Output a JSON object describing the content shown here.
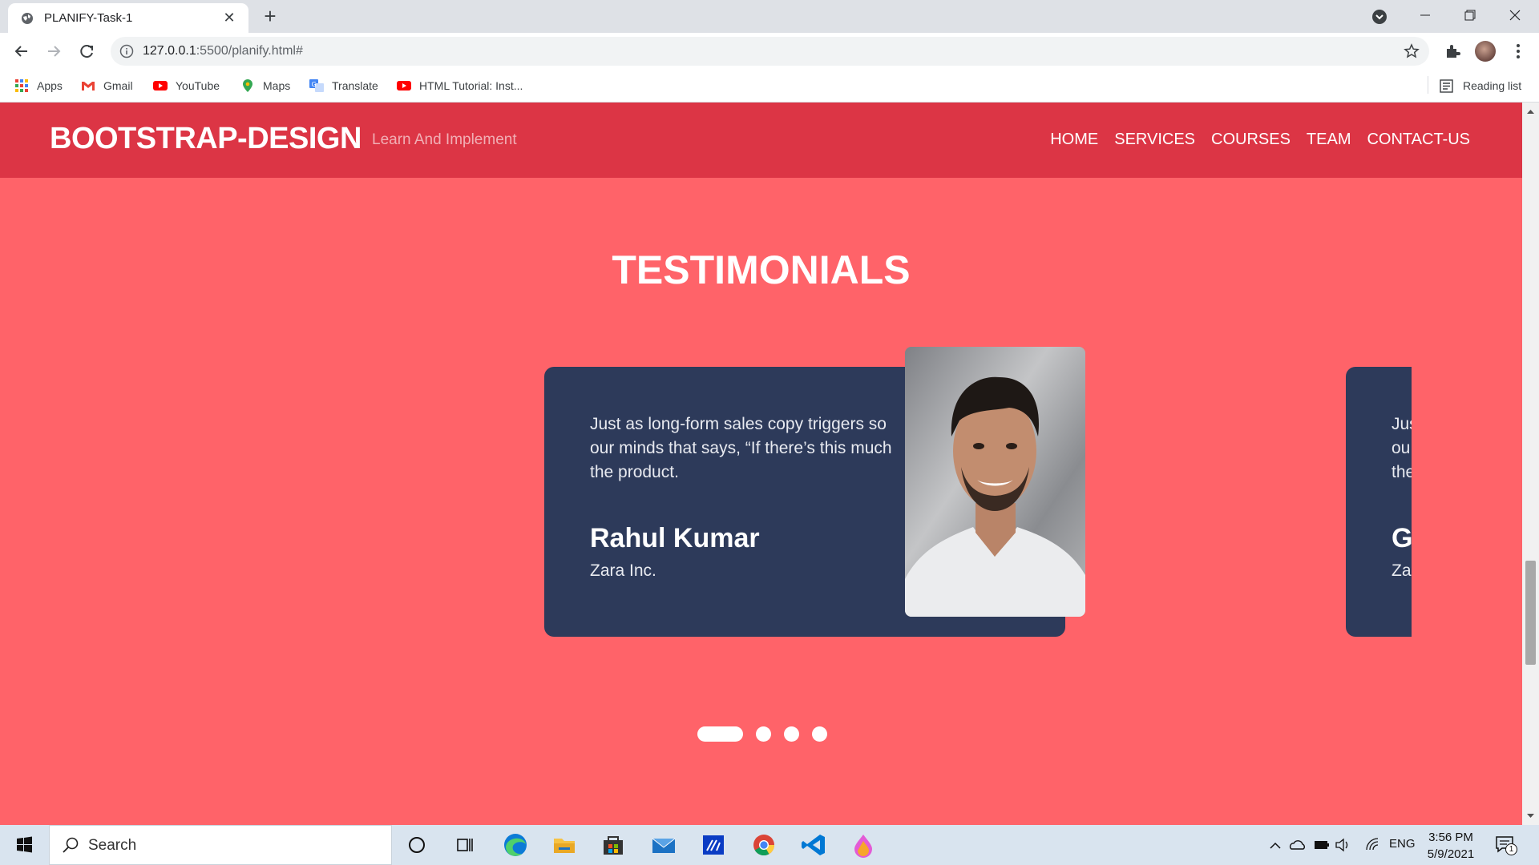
{
  "browser": {
    "tab_title": "PLANIFY-Task-1",
    "url_host": "127.0.0.1",
    "url_rest": ":5500/planify.html#",
    "bookmarks": [
      {
        "label": "Apps",
        "icon": "apps-grid-icon"
      },
      {
        "label": "Gmail",
        "icon": "gmail-icon"
      },
      {
        "label": "YouTube",
        "icon": "youtube-icon"
      },
      {
        "label": "Maps",
        "icon": "maps-icon"
      },
      {
        "label": "Translate",
        "icon": "translate-icon"
      },
      {
        "label": "HTML Tutorial: Inst...",
        "icon": "youtube-icon"
      }
    ],
    "reading_list": "Reading list"
  },
  "site": {
    "brand": "BOOTSTRAP-DESIGN",
    "tagline": "Learn And Implement",
    "nav": [
      "HOME",
      "SERVICES",
      "COURSES",
      "TEAM",
      "CONTACT-US"
    ],
    "colors": {
      "navbar": "#dc3545",
      "background": "#ff6369",
      "card": "#2d3a5a"
    }
  },
  "testimonials": {
    "title": "TESTIMONIALS",
    "active": {
      "quote_lines": [
        "Just as long-form sales copy triggers so",
        "our minds that says, “If there’s this much",
        "the product."
      ],
      "name": "Rahul Kumar",
      "company": "Zara Inc."
    },
    "next": {
      "quote_lines": [
        "Jus",
        "ou",
        "the"
      ],
      "name": "G",
      "company": "Za"
    },
    "dots_count": 4,
    "active_dot": 1
  },
  "taskbar": {
    "search_placeholder": "Search",
    "lang": "ENG",
    "time": "3:56 PM",
    "date": "5/9/2021",
    "notification_count": "1"
  }
}
